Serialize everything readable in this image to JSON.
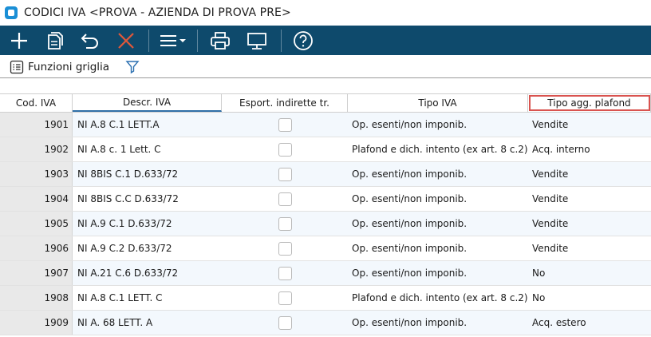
{
  "window": {
    "title": "CODICI IVA <PROVA - AZIENDA DI PROVA PRE>"
  },
  "toolbar": {
    "icons": [
      "plus-icon",
      "copy-icon",
      "undo-icon",
      "close-icon",
      "menu-icon",
      "print-icon",
      "monitor-icon",
      "help-icon"
    ]
  },
  "subbar": {
    "grid_functions_label": "Funzioni griglia"
  },
  "grid": {
    "columns": [
      "Cod. IVA",
      "Descr. IVA",
      "Esport. indirette tr.",
      "Tipo IVA",
      "Tipo agg. plafond"
    ],
    "rows": [
      {
        "code": "1901",
        "descr": "NI A.8 C.1 LETT.A",
        "esport": false,
        "tipo": "Op. esenti/non imponib.",
        "plafond": "Vendite"
      },
      {
        "code": "1902",
        "descr": "NI A.8 c. 1 Lett. C",
        "esport": false,
        "tipo": "Plafond e dich. intento (ex art. 8 c.2)",
        "plafond": "Acq. interno"
      },
      {
        "code": "1903",
        "descr": "NI 8BIS C.1 D.633/72",
        "esport": false,
        "tipo": "Op. esenti/non imponib.",
        "plafond": "Vendite"
      },
      {
        "code": "1904",
        "descr": "NI 8BIS C.C D.633/72",
        "esport": false,
        "tipo": "Op. esenti/non imponib.",
        "plafond": "Vendite"
      },
      {
        "code": "1905",
        "descr": "NI A.9 C.1 D.633/72",
        "esport": false,
        "tipo": "Op. esenti/non imponib.",
        "plafond": "Vendite"
      },
      {
        "code": "1906",
        "descr": "NI A.9 C.2 D.633/72",
        "esport": false,
        "tipo": "Op. esenti/non imponib.",
        "plafond": "Vendite"
      },
      {
        "code": "1907",
        "descr": "NI A.21 C.6 D.633/72",
        "esport": false,
        "tipo": "Op. esenti/non imponib.",
        "plafond": "No"
      },
      {
        "code": "1908",
        "descr": "NI A.8 C.1 LETT. C",
        "esport": false,
        "tipo": "Plafond e dich. intento (ex art. 8 c.2)",
        "plafond": "No"
      },
      {
        "code": "1909",
        "descr": "NI A. 68 LETT. A",
        "esport": false,
        "tipo": "Op. esenti/non imponib.",
        "plafond": "Acq. estero"
      }
    ]
  },
  "colors": {
    "toolbar_bg": "#0e4a6c",
    "accent": "#1a8fd6",
    "highlight_border": "#d9534f",
    "close_icon": "#e0583a"
  }
}
